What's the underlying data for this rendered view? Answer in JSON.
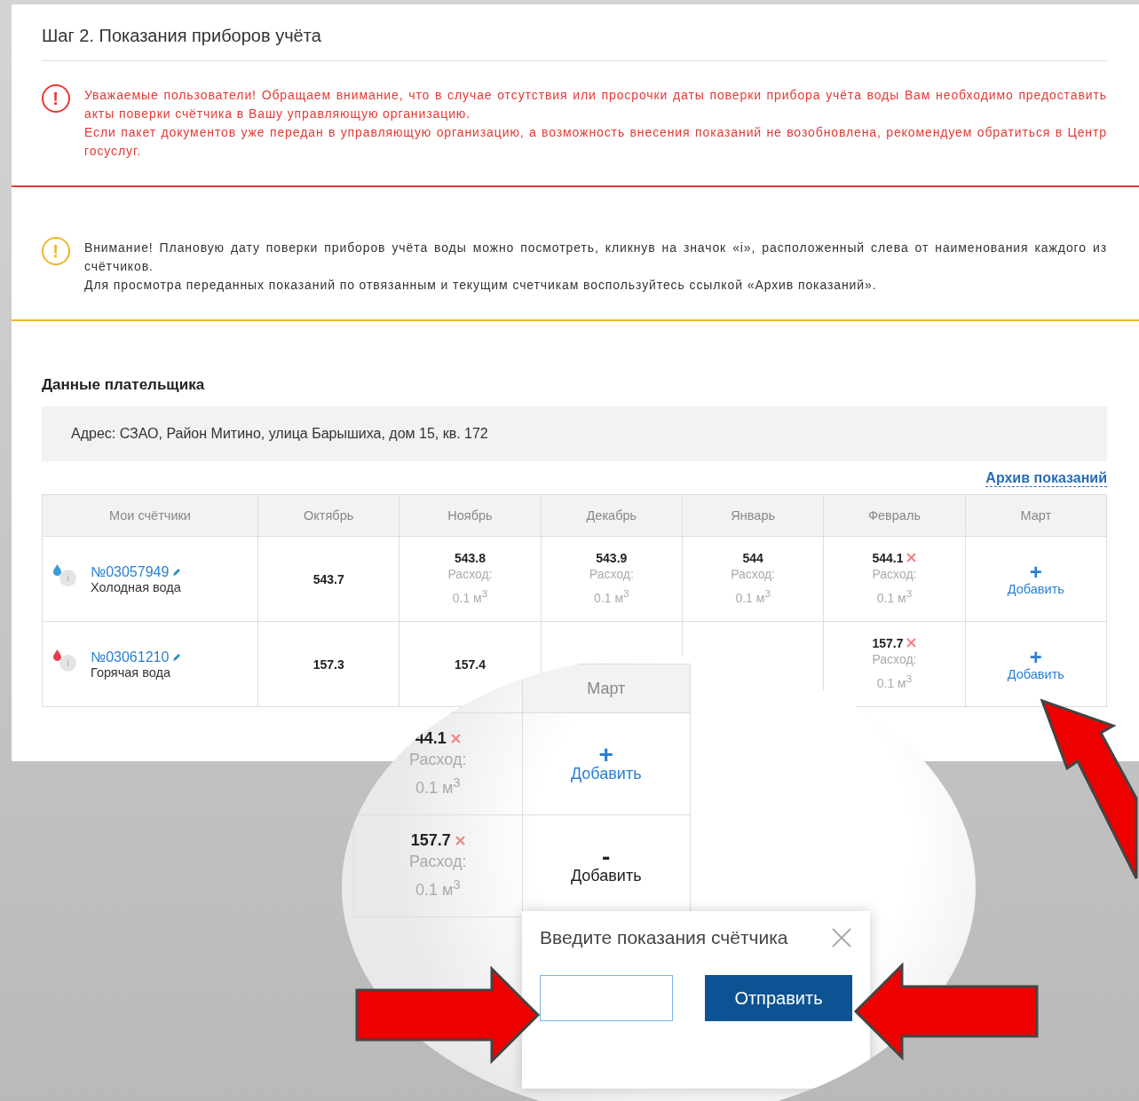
{
  "step_title": "Шаг 2. Показания приборов учёта",
  "alerts": [
    {
      "kind": "error",
      "icon": "!",
      "paragraphs": [
        "Уважаемые пользователи! Обращаем внимание, что в случае отсутствия или просрочки даты поверки прибора учёта воды Вам необходимо предоставить акты поверки счётчика в Вашу управляющую организацию.",
        "Если пакет документов уже передан в управляющую организацию, а возможность внесения показаний не возобновлена, рекомендуем обратиться в Центр госуслуг."
      ]
    },
    {
      "kind": "warning",
      "icon": "!",
      "paragraphs": [
        "Внимание! Плановую дату поверки приборов учёта воды можно посмотреть, кликнув на значок «i», расположенный слева от наименования каждого из счётчиков.",
        "Для просмотра переданных показаний по отвязанным и текущим счетчикам воспользуйтесь ссылкой «Архив показаний»."
      ]
    }
  ],
  "payer": {
    "heading": "Данные плательщика",
    "address": "Адрес: СЗАО, Район Митино, улица Барышиха, дом 15, кв. 172"
  },
  "archive_link": "Архив показаний",
  "table": {
    "columns": [
      "Мои счётчики",
      "Октябрь",
      "Ноябрь",
      "Декабрь",
      "Январь",
      "Февраль",
      "Март"
    ],
    "rows": [
      {
        "cells": [
          {
            "kind": "meter",
            "color": "#3a9ad9",
            "info_icon": "i",
            "number": "№03057949",
            "type": "Холодная вода"
          },
          {
            "kind": "reading",
            "value": "543.7",
            "deletable": false
          },
          {
            "kind": "reading",
            "value": "543.8",
            "deletable": false,
            "usage_label": "Расход:",
            "usage": "0.1 м$^{3}$"
          },
          {
            "kind": "reading",
            "value": "543.9",
            "deletable": false,
            "usage_label": "Расход:",
            "usage": "0.1 м$^{3}$"
          },
          {
            "kind": "reading",
            "value": "544",
            "deletable": false,
            "usage_label": "Расход:",
            "usage": "0.1 м$^{3}$"
          },
          {
            "kind": "reading",
            "value": "544.1",
            "deletable": true,
            "usage_label": "Расход:",
            "usage": "0.1 м$^{3}$"
          },
          {
            "kind": "add",
            "sign": "+",
            "label": "Добавить"
          }
        ]
      },
      {
        "cells": [
          {
            "kind": "meter",
            "color": "#e0414a",
            "info_icon": "i",
            "number": "№03061210",
            "type": "Горячая вода"
          },
          {
            "kind": "reading",
            "value": "157.3",
            "deletable": false
          },
          {
            "kind": "reading",
            "value": "157.4",
            "deletable": false
          },
          {
            "kind": "reading"
          },
          {
            "kind": "reading"
          },
          {
            "kind": "reading",
            "value": "157.7",
            "deletable": true,
            "usage_label": "Расход:",
            "usage": "0.1 м$^{3}$"
          },
          {
            "kind": "add",
            "sign": "+",
            "label": "Добавить"
          }
        ]
      }
    ]
  },
  "magnifier": {
    "header": "Март",
    "rows": [
      {
        "value": "44.1",
        "deletable": true,
        "usage_label": "Расход:",
        "usage": "0.1 м$^{3}$",
        "add": {
          "sign": "+",
          "label": "Добавить",
          "expanded": false
        }
      },
      {
        "value": "157.7",
        "deletable": true,
        "usage_label": "Расход:",
        "usage": "0.1 м$^{3}$",
        "add": {
          "sign": "-",
          "label": "Добавить",
          "expanded": true
        }
      }
    ],
    "popup": {
      "title": "Введите показания счётчика",
      "submit": "Отправить"
    }
  }
}
